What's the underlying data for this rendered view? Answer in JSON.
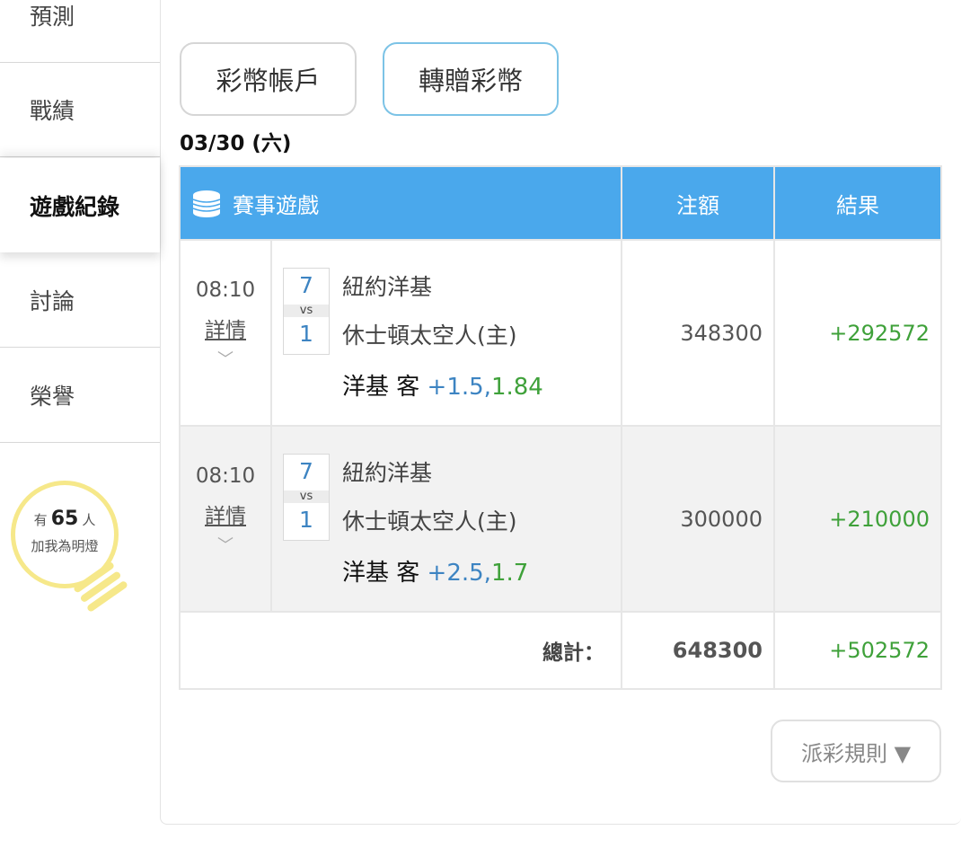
{
  "sidebar": {
    "items": [
      {
        "label": "預測"
      },
      {
        "label": "戰績"
      },
      {
        "label": "遊戲紀錄"
      },
      {
        "label": "討論"
      },
      {
        "label": "榮譽"
      }
    ],
    "bulb": {
      "prefix": "有",
      "count": "65",
      "suffix": "人",
      "line2": "加我為明燈",
      "color": "#f6e88a"
    }
  },
  "tabs": {
    "account": "彩幣帳戶",
    "gift": "轉贈彩幣"
  },
  "date": "03/30 (六)",
  "table": {
    "headers": {
      "game": "賽事遊戲",
      "amount": "注額",
      "result": "結果"
    },
    "header_icon": "coin-stack-icon",
    "header_color": "#4aa8ec",
    "rows": [
      {
        "time": "08:10",
        "detail": "詳情",
        "score_away": "7",
        "vs": "vs",
        "score_home": "1",
        "team_away": "紐約洋基",
        "team_home": "休士頓太空人(主)",
        "bet_team": "洋基 客",
        "handicap": "+1.5,",
        "odds": "1.84",
        "amount": "348300",
        "result": "+292572"
      },
      {
        "time": "08:10",
        "detail": "詳情",
        "score_away": "7",
        "vs": "vs",
        "score_home": "1",
        "team_away": "紐約洋基",
        "team_home": "休士頓太空人(主)",
        "bet_team": "洋基 客",
        "handicap": "+2.5,",
        "odds": "1.7",
        "amount": "300000",
        "result": "+210000"
      }
    ],
    "total": {
      "label": "總計：",
      "amount": "648300",
      "result": "+502572"
    }
  },
  "rules_button": "派彩規則 ▼",
  "colors": {
    "win": "#3fa13a",
    "score": "#3d84c2"
  }
}
